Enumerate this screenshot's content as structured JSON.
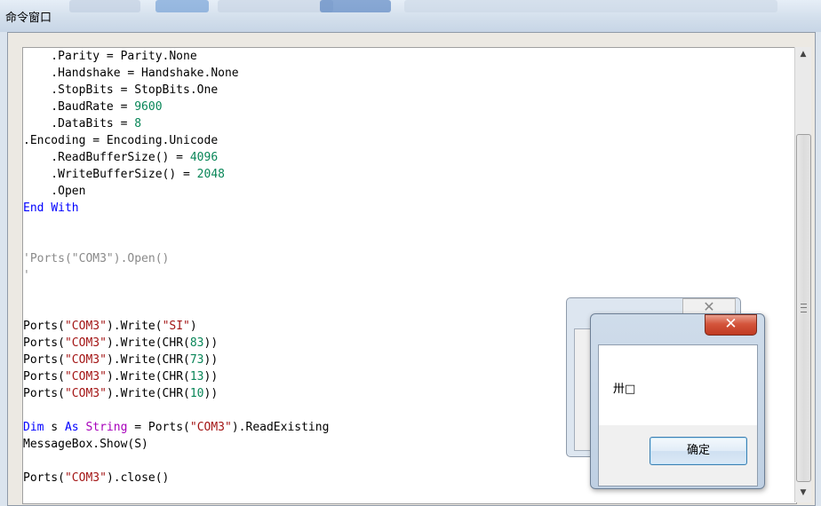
{
  "window": {
    "title": "命令窗口"
  },
  "editor": {
    "lines": [
      [
        {
          "t": "    .Parity = Parity.None",
          "c": ""
        }
      ],
      [
        {
          "t": "    .Handshake = Handshake.None",
          "c": ""
        }
      ],
      [
        {
          "t": "    .StopBits = StopBits.One",
          "c": ""
        }
      ],
      [
        {
          "t": "    .BaudRate = ",
          "c": ""
        },
        {
          "t": "9600",
          "c": "num"
        }
      ],
      [
        {
          "t": "    .DataBits = ",
          "c": ""
        },
        {
          "t": "8",
          "c": "num"
        }
      ],
      [
        {
          "t": ".Encoding = Encoding.Unicode",
          "c": ""
        }
      ],
      [
        {
          "t": "    .ReadBufferSize() = ",
          "c": ""
        },
        {
          "t": "4096",
          "c": "num"
        }
      ],
      [
        {
          "t": "    .WriteBufferSize() = ",
          "c": ""
        },
        {
          "t": "2048",
          "c": "num"
        }
      ],
      [
        {
          "t": "    .Open",
          "c": ""
        }
      ],
      [
        {
          "t": "End",
          "c": "kw"
        },
        {
          "t": " ",
          "c": ""
        },
        {
          "t": "With",
          "c": "kw"
        }
      ],
      [],
      [],
      [
        {
          "t": "'Ports(\"COM3\").Open()",
          "c": "cmt"
        }
      ],
      [
        {
          "t": "'",
          "c": "cmt"
        }
      ],
      [],
      [],
      [
        {
          "t": "Ports(",
          "c": ""
        },
        {
          "t": "\"COM3\"",
          "c": "str"
        },
        {
          "t": ").Write(",
          "c": ""
        },
        {
          "t": "\"SI\"",
          "c": "str"
        },
        {
          "t": ")",
          "c": ""
        }
      ],
      [
        {
          "t": "Ports(",
          "c": ""
        },
        {
          "t": "\"COM3\"",
          "c": "str"
        },
        {
          "t": ").Write(CHR(",
          "c": ""
        },
        {
          "t": "83",
          "c": "num"
        },
        {
          "t": "))",
          "c": ""
        }
      ],
      [
        {
          "t": "Ports(",
          "c": ""
        },
        {
          "t": "\"COM3\"",
          "c": "str"
        },
        {
          "t": ").Write(CHR(",
          "c": ""
        },
        {
          "t": "73",
          "c": "num"
        },
        {
          "t": "))",
          "c": ""
        }
      ],
      [
        {
          "t": "Ports(",
          "c": ""
        },
        {
          "t": "\"COM3\"",
          "c": "str"
        },
        {
          "t": ").Write(CHR(",
          "c": ""
        },
        {
          "t": "13",
          "c": "num"
        },
        {
          "t": "))",
          "c": ""
        }
      ],
      [
        {
          "t": "Ports(",
          "c": ""
        },
        {
          "t": "\"COM3\"",
          "c": "str"
        },
        {
          "t": ").Write(CHR(",
          "c": ""
        },
        {
          "t": "10",
          "c": "num"
        },
        {
          "t": "))",
          "c": ""
        }
      ],
      [],
      [
        {
          "t": "Dim",
          "c": "kw"
        },
        {
          "t": " s ",
          "c": ""
        },
        {
          "t": "As",
          "c": "kw"
        },
        {
          "t": " ",
          "c": ""
        },
        {
          "t": "String",
          "c": "kw2"
        },
        {
          "t": " = Ports(",
          "c": ""
        },
        {
          "t": "\"COM3\"",
          "c": "str"
        },
        {
          "t": ").ReadExisting",
          "c": ""
        }
      ],
      [
        {
          "t": "MessageBox.Show(S)",
          "c": ""
        }
      ],
      [],
      [
        {
          "t": "Ports(",
          "c": ""
        },
        {
          "t": "\"COM3\"",
          "c": "str"
        },
        {
          "t": ").close()",
          "c": ""
        }
      ]
    ]
  },
  "scrollbar": {
    "up_icon": "up-arrow-icon",
    "down_icon": "down-arrow-icon",
    "up_glyph": "▲",
    "down_glyph": "▼"
  },
  "background_dialog": {
    "close_glyph": "✕"
  },
  "message_box": {
    "close_glyph": "✕",
    "message": "卅□",
    "ok_label": "确定"
  }
}
